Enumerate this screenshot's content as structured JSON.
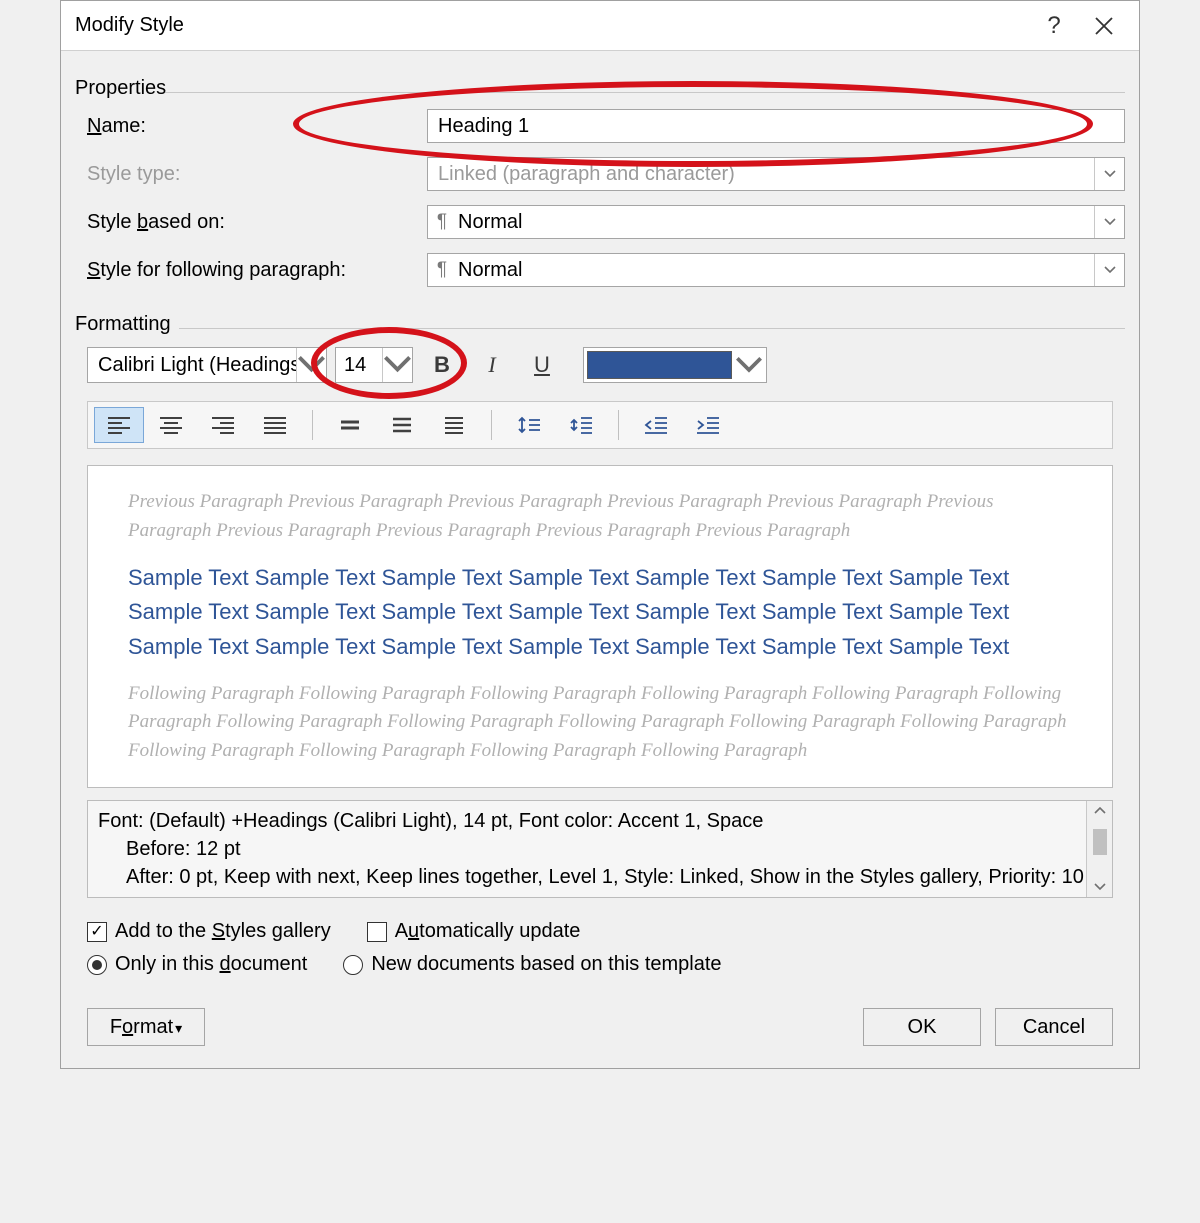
{
  "titlebar": {
    "title": "Modify Style",
    "help": "?",
    "close_aria": "Close"
  },
  "sections": {
    "properties": "Properties",
    "formatting": "Formatting"
  },
  "properties": {
    "name_label": "Name:",
    "name_value": "Heading 1",
    "type_label": "Style type:",
    "type_value": "Linked (paragraph and character)",
    "based_label": "Style based on:",
    "based_value": "Normal",
    "following_label": "Style for following paragraph:",
    "following_value": "Normal",
    "pilcrow": "¶"
  },
  "formatting": {
    "font_name": "Calibri Light (Headings)",
    "font_size": "14",
    "bold": "B",
    "italic": "I",
    "underline": "U",
    "color_hex": "#2f5597"
  },
  "preview": {
    "prev": "Previous Paragraph Previous Paragraph Previous Paragraph Previous Paragraph Previous Paragraph Previous Paragraph Previous Paragraph Previous Paragraph Previous Paragraph Previous Paragraph",
    "sample": "Sample Text Sample Text Sample Text Sample Text Sample Text Sample Text Sample Text Sample Text Sample Text Sample Text Sample Text Sample Text Sample Text Sample Text Sample Text Sample Text Sample Text Sample Text Sample Text Sample Text Sample Text",
    "next": "Following Paragraph Following Paragraph Following Paragraph Following Paragraph Following Paragraph Following Paragraph Following Paragraph Following Paragraph Following Paragraph Following Paragraph Following Paragraph Following Paragraph Following Paragraph Following Paragraph Following Paragraph"
  },
  "description": {
    "line1": "Font: (Default) +Headings (Calibri Light), 14 pt, Font color: Accent 1, Space",
    "line2": "Before:  12 pt",
    "line3": "After:  0 pt, Keep with next, Keep lines together, Level 1, Style: Linked, Show in the Styles gallery, Priority: 10"
  },
  "options": {
    "add_gallery": "Add to the Styles gallery",
    "auto_update": "Automatically update",
    "only_doc": "Only in this document",
    "new_docs": "New documents based on this template"
  },
  "buttons": {
    "format": "Format",
    "ok": "OK",
    "cancel": "Cancel"
  },
  "annotations": [
    {
      "id": "oval-name",
      "target": "Name field"
    },
    {
      "id": "oval-size",
      "target": "Font size combo"
    }
  ]
}
